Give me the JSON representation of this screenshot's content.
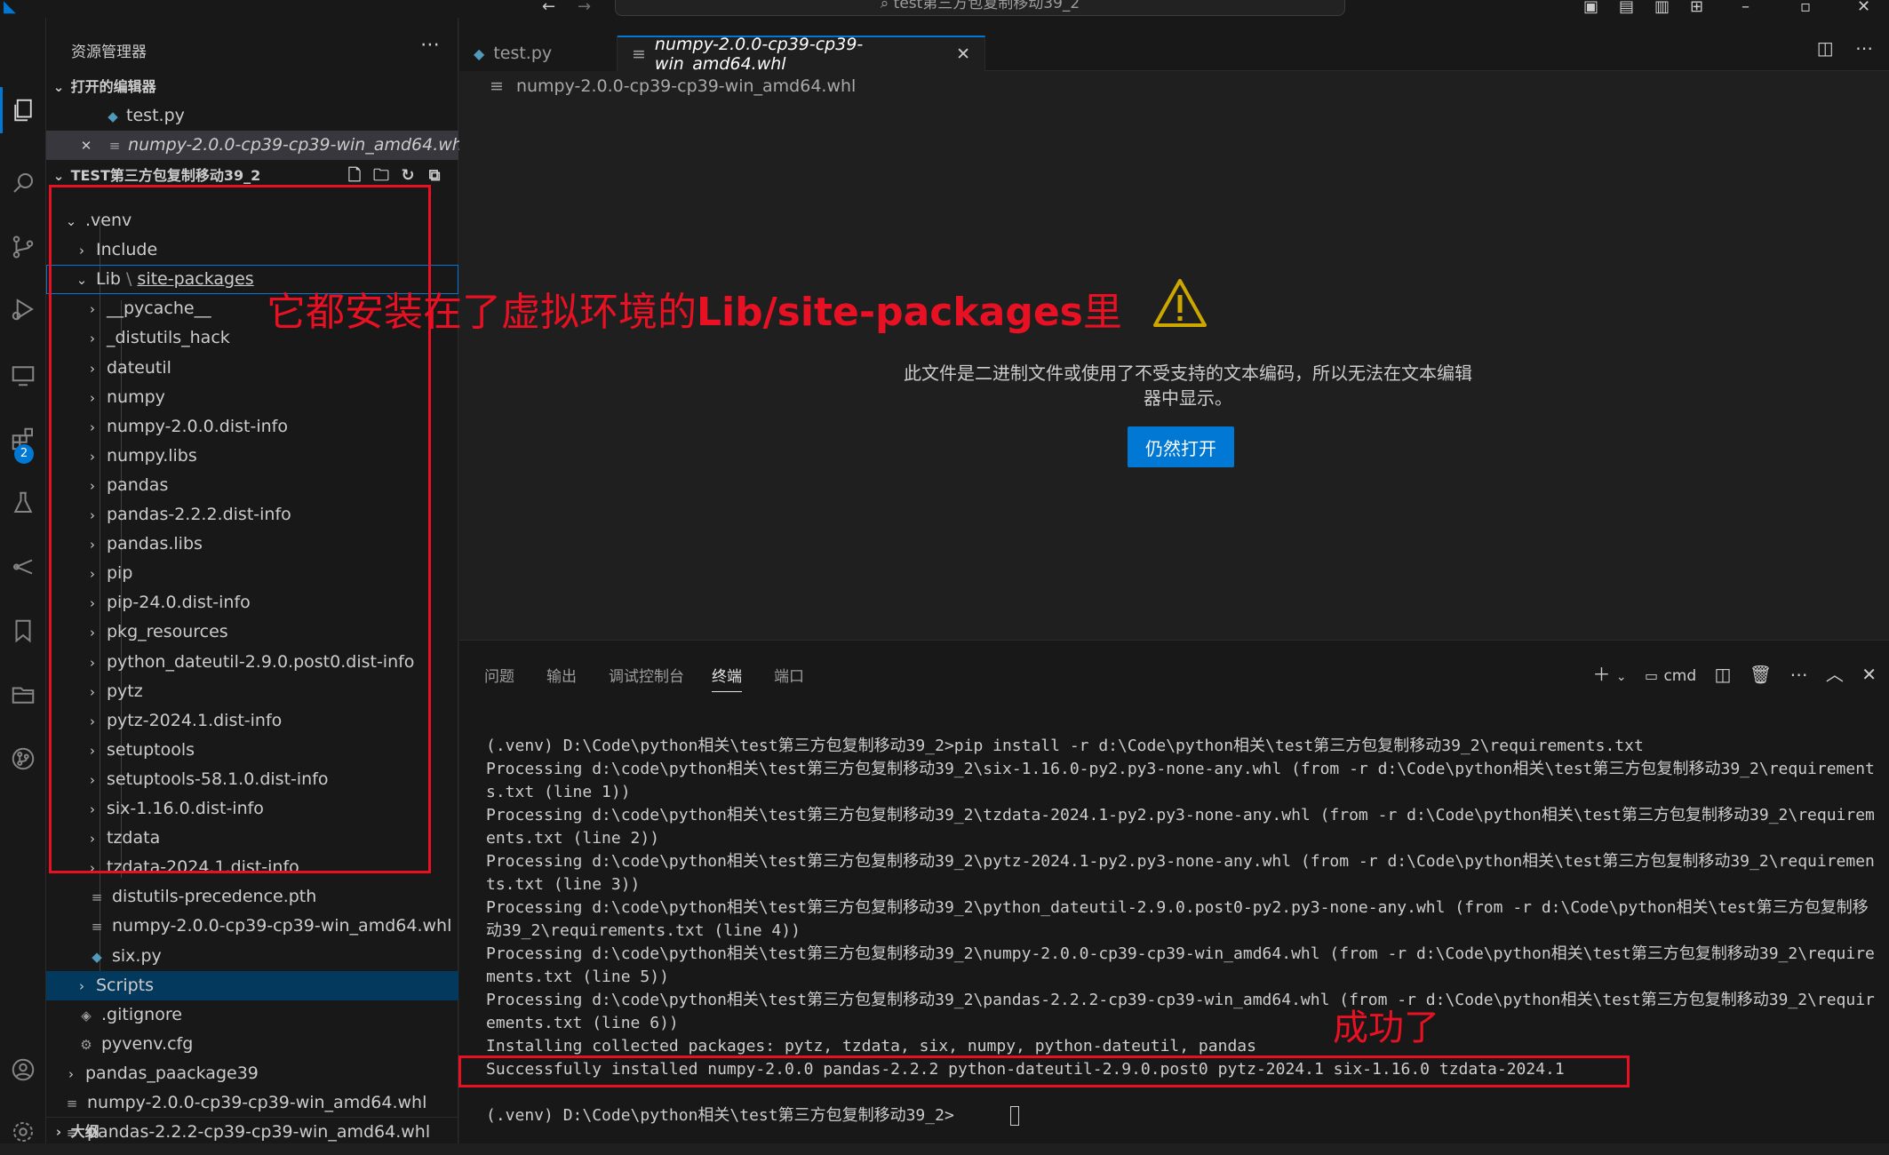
{
  "window": {
    "search_text": "test第三方包复制移动39_2"
  },
  "activity_bar": {
    "icons": [
      "explorer-icon",
      "search-icon",
      "source-control-icon",
      "run-debug-icon",
      "remote-explorer-icon",
      "extensions-icon",
      "testing-icon",
      "git-lens-icon",
      "bookmarks-icon",
      "project-manager-icon",
      "git-graph-icon",
      "accounts-icon",
      "manage-icon"
    ],
    "extensions_badge": "2"
  },
  "sidebar": {
    "title": "资源管理器",
    "open_editors": {
      "heading": "打开的编辑器",
      "items": [
        {
          "label": "test.py"
        },
        {
          "label": "numpy-2.0.0-cp39-cp39-win_amd64.whl"
        }
      ]
    },
    "workspace": {
      "heading": "TEST第三方包复制移动39_2",
      "items": [
        {
          "label": ".venv"
        },
        {
          "label": "Include"
        },
        {
          "label": "Lib",
          "label2": "site-packages"
        },
        {
          "label": "__pycache__"
        },
        {
          "label": "_distutils_hack"
        },
        {
          "label": "dateutil"
        },
        {
          "label": "numpy"
        },
        {
          "label": "numpy-2.0.0.dist-info"
        },
        {
          "label": "numpy.libs"
        },
        {
          "label": "pandas"
        },
        {
          "label": "pandas-2.2.2.dist-info"
        },
        {
          "label": "pandas.libs"
        },
        {
          "label": "pip"
        },
        {
          "label": "pip-24.0.dist-info"
        },
        {
          "label": "pkg_resources"
        },
        {
          "label": "python_dateutil-2.9.0.post0.dist-info"
        },
        {
          "label": "pytz"
        },
        {
          "label": "pytz-2024.1.dist-info"
        },
        {
          "label": "setuptools"
        },
        {
          "label": "setuptools-58.1.0.dist-info"
        },
        {
          "label": "six-1.16.0.dist-info"
        },
        {
          "label": "tzdata"
        },
        {
          "label": "tzdata-2024.1.dist-info"
        },
        {
          "label": "distutils-precedence.pth"
        },
        {
          "label": "numpy-2.0.0-cp39-cp39-win_amd64.whl"
        },
        {
          "label": "six.py"
        },
        {
          "label": "Scripts"
        },
        {
          "label": ".gitignore"
        },
        {
          "label": "pyvenv.cfg"
        },
        {
          "label": "pandas_paackage39"
        },
        {
          "label": "numpy-2.0.0-cp39-cp39-win_amd64.whl"
        },
        {
          "label": "pandas-2.2.2-cp39-cp39-win_amd64.whl"
        }
      ]
    },
    "outline_heading": "大纲"
  },
  "tabs": [
    {
      "label": "test.py"
    },
    {
      "label": "numpy-2.0.0-cp39-cp39-win_amd64.whl"
    }
  ],
  "editor": {
    "breadcrumb": "numpy-2.0.0-cp39-cp39-win_amd64.whl",
    "message_line1": "此文件是二进制文件或使用了不受支持的文本编码，所以无法在文本编辑",
    "message_line2": "器中显示。",
    "open_anyway": "仍然打开"
  },
  "panel": {
    "tabs": [
      "问题",
      "输出",
      "调试控制台",
      "终端",
      "端口"
    ],
    "active_tab": "终端",
    "shell_label": "cmd",
    "terminal_lines": [
      "(.venv) D:\\Code\\python相关\\test第三方包复制移动39_2>pip install -r d:\\Code\\python相关\\test第三方包复制移动39_2\\requirements.txt",
      "Processing d:\\code\\python相关\\test第三方包复制移动39_2\\six-1.16.0-py2.py3-none-any.whl (from -r d:\\Code\\python相关\\test第三方包复制移动39_2\\requirements.txt (line 1))",
      "Processing d:\\code\\python相关\\test第三方包复制移动39_2\\tzdata-2024.1-py2.py3-none-any.whl (from -r d:\\Code\\python相关\\test第三方包复制移动39_2\\requirements.txt (line 2))",
      "Processing d:\\code\\python相关\\test第三方包复制移动39_2\\pytz-2024.1-py2.py3-none-any.whl (from -r d:\\Code\\python相关\\test第三方包复制移动39_2\\requirements.txt (line 3))",
      "Processing d:\\code\\python相关\\test第三方包复制移动39_2\\python_dateutil-2.9.0.post0-py2.py3-none-any.whl (from -r d:\\Code\\python相关\\test第三方包复制移动39_2\\requirements.txt (line 4))",
      "Processing d:\\code\\python相关\\test第三方包复制移动39_2\\numpy-2.0.0-cp39-cp39-win_amd64.whl (from -r d:\\Code\\python相关\\test第三方包复制移动39_2\\requirements.txt (line 5))",
      "Processing d:\\code\\python相关\\test第三方包复制移动39_2\\pandas-2.2.2-cp39-cp39-win_amd64.whl (from -r d:\\Code\\python相关\\test第三方包复制移动39_2\\requirements.txt (line 6))",
      "Installing collected packages: pytz, tzdata, six, numpy, python-dateutil, pandas",
      "Successfully installed numpy-2.0.0 pandas-2.2.2 python-dateutil-2.9.0.post0 pytz-2024.1 six-1.16.0 tzdata-2024.1",
      "",
      "(.venv) D:\\Code\\python相关\\test第三方包复制移动39_2>"
    ]
  },
  "annotations": {
    "note_prefix": "它都安装在了虚拟环境的",
    "note_bold": "Lib/site-packages",
    "note_suffix": "里",
    "success_note": "成功了"
  },
  "colors": {
    "accent": "#0078d4",
    "annotation_red": "#e81123",
    "warning_yellow": "#cca700"
  }
}
